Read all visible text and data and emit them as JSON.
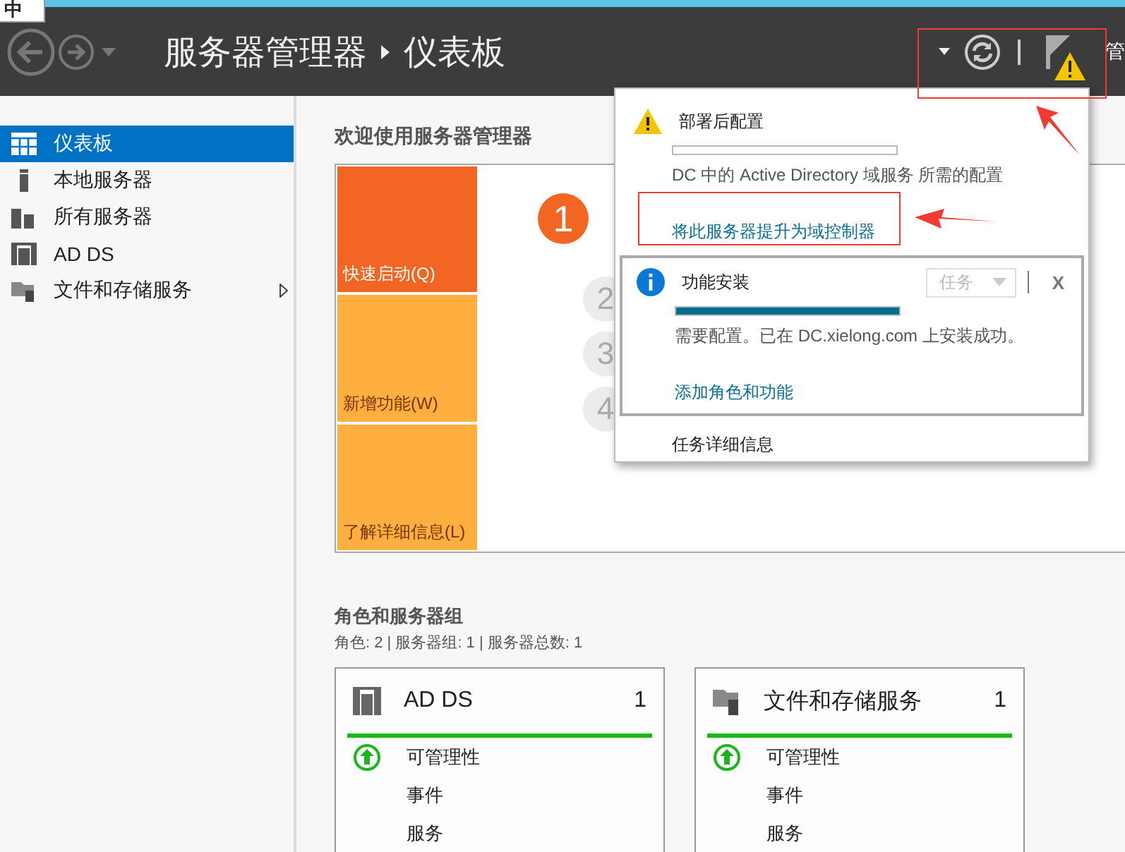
{
  "ime_indicator": "中",
  "header": {
    "title": "服务器管理器",
    "page": "仪表板",
    "clipped_menu": "管",
    "flag_warning": true
  },
  "sidebar": {
    "items": [
      {
        "label": "仪表板",
        "selected": true,
        "kind": "dashboard",
        "expandable": false
      },
      {
        "label": "本地服务器",
        "selected": false,
        "kind": "server",
        "expandable": false
      },
      {
        "label": "所有服务器",
        "selected": false,
        "kind": "servers",
        "expandable": false
      },
      {
        "label": "AD DS",
        "selected": false,
        "kind": "adds",
        "expandable": false
      },
      {
        "label": "文件和存储服务",
        "selected": false,
        "kind": "files",
        "expandable": true
      }
    ]
  },
  "welcome": {
    "title": "欢迎使用服务器管理器",
    "tiles": [
      {
        "label": "快速启动(Q)",
        "selected": true
      },
      {
        "label": "新增功能(W)",
        "selected": false
      },
      {
        "label": "了解详细信息(L)",
        "selected": false
      }
    ],
    "steps": [
      {
        "number": "1",
        "selected": true
      },
      {
        "number": "2",
        "selected": false
      },
      {
        "number": "3",
        "selected": false
      },
      {
        "number": "4",
        "selected": false
      }
    ]
  },
  "roles": {
    "title": "角色和服务器组",
    "summary": "角色: 2 | 服务器组: 1 | 服务器总数: 1",
    "cards": [
      {
        "title": "AD DS",
        "count": "1",
        "kind": "adds",
        "rows": [
          {
            "label": "可管理性",
            "ok": true
          },
          {
            "label": "事件",
            "ok": false
          },
          {
            "label": "服务",
            "ok": false
          }
        ]
      },
      {
        "title": "文件和存储服务",
        "count": "1",
        "kind": "files",
        "rows": [
          {
            "label": "可管理性",
            "ok": true
          },
          {
            "label": "事件",
            "ok": false
          },
          {
            "label": "服务",
            "ok": false
          }
        ]
      }
    ]
  },
  "notification_popup": {
    "items": [
      {
        "kind": "warning",
        "title": "部署后配置",
        "level": 0,
        "message": "DC 中的 Active Directory 域服务 所需的配置",
        "link": "将此服务器提升为域控制器"
      },
      {
        "kind": "info",
        "title": "功能安装",
        "level": 1,
        "task_menu": {
          "label": "任务",
          "disabled": true
        },
        "close": "X",
        "message": "需要配置。已在 DC.xielong.com 上安装成功。",
        "link": "添加角色和功能"
      }
    ],
    "footer": "任务详细信息"
  }
}
